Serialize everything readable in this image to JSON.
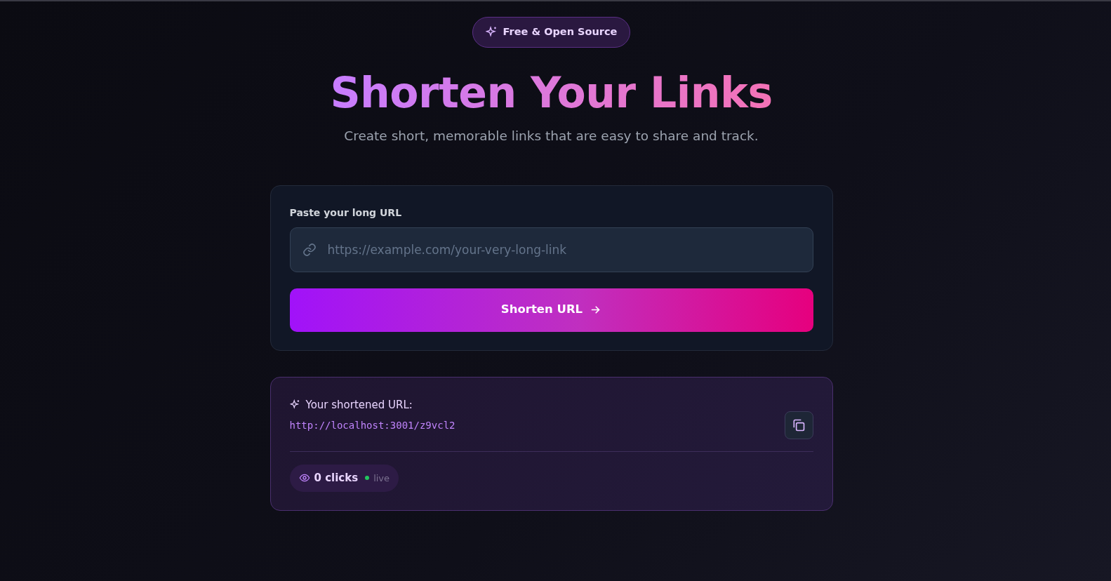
{
  "badge": {
    "label": "Free & Open Source"
  },
  "hero": {
    "title": "Shorten Your Links",
    "subtitle": "Create short, memorable links that are easy to share and track."
  },
  "form": {
    "label": "Paste your long URL",
    "placeholder": "https://example.com/your-very-long-link",
    "button": "Shorten URL"
  },
  "result": {
    "heading": "Your shortened URL:",
    "url": "http://localhost:3001/z9vcl2",
    "clicks": "0 clicks",
    "live": true,
    "live_label": "live"
  }
}
